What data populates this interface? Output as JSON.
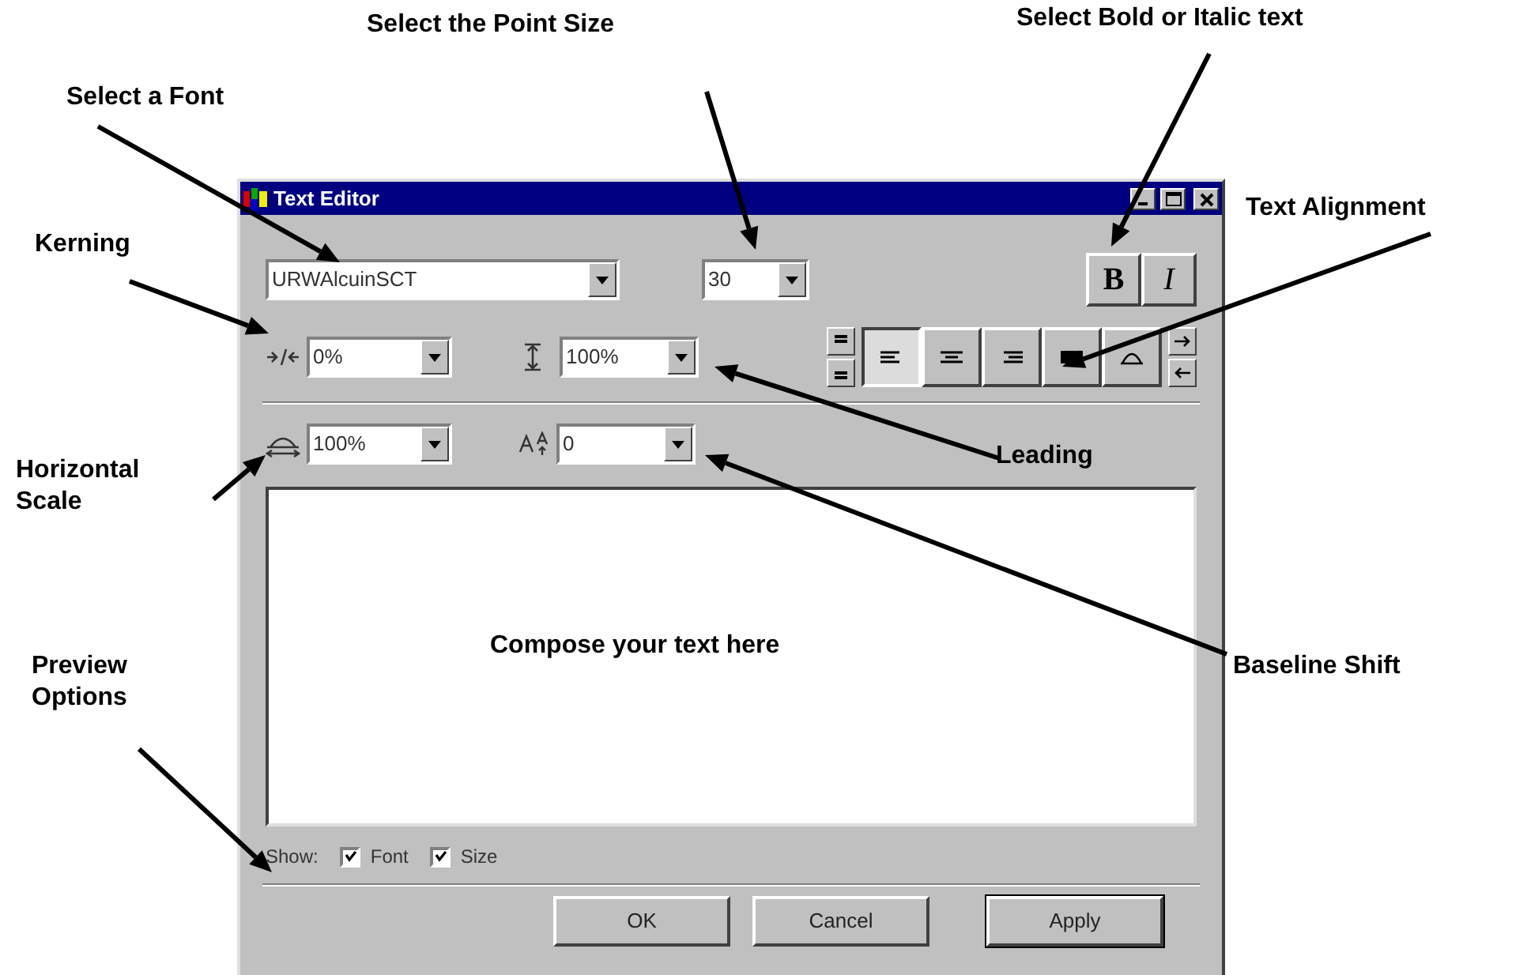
{
  "window": {
    "title": "Text Editor"
  },
  "font_field": {
    "value": "URWAlcuinSCT"
  },
  "size_field": {
    "value": "30"
  },
  "style_buttons": [
    {
      "label": "B",
      "selected": false
    },
    {
      "label": "I",
      "selected": false
    }
  ],
  "kerning_field": {
    "value": "0%"
  },
  "leading_field": {
    "value": "100%"
  },
  "alignment_buttons": [
    {
      "kind": "left",
      "selected": true
    },
    {
      "kind": "center",
      "selected": false
    },
    {
      "kind": "right",
      "selected": false
    },
    {
      "kind": "justify",
      "selected": false
    },
    {
      "kind": "arc",
      "selected": false
    }
  ],
  "scale_field": {
    "value": "100%"
  },
  "baseline_field": {
    "value": "0"
  },
  "preview": {
    "label": "Show:",
    "options": [
      {
        "label": "Font",
        "checked": true
      },
      {
        "label": "Size",
        "checked": true
      }
    ]
  },
  "buttons": [
    {
      "label": "OK",
      "default": false
    },
    {
      "label": "Cancel",
      "default": false
    },
    {
      "label": "Apply",
      "default": true
    }
  ],
  "annotations": [
    {
      "text": "Select the Point Size"
    },
    {
      "text": "Select Bold or Italic text"
    },
    {
      "text": "Select a Font"
    },
    {
      "text": "Kerning"
    },
    {
      "text": "Text Alignment"
    },
    {
      "text": "Horizontal Scale"
    },
    {
      "text": "Leading"
    },
    {
      "text": "Compose your text here"
    },
    {
      "text": "Baseline Shift"
    },
    {
      "text": "Preview Options"
    }
  ]
}
